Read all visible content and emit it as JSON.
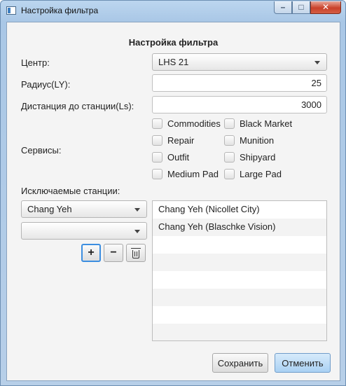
{
  "window": {
    "title": "Настройка фильтра",
    "controls": {
      "minimize": "–",
      "maximize": "□",
      "close": "✕"
    }
  },
  "form": {
    "heading": "Настройка фильтра",
    "center": {
      "label": "Центр:",
      "value": "LHS 21"
    },
    "radius": {
      "label": "Радиус(LY):",
      "value": "25"
    },
    "distance": {
      "label": "Дистанция до станции(Ls):",
      "value": "3000"
    },
    "services": {
      "label": "Сервисы:",
      "items": [
        {
          "label": "Commodities",
          "checked": false
        },
        {
          "label": "Black Market",
          "checked": false
        },
        {
          "label": "Repair",
          "checked": false
        },
        {
          "label": "Munition",
          "checked": false
        },
        {
          "label": "Outfit",
          "checked": false
        },
        {
          "label": "Shipyard",
          "checked": false
        },
        {
          "label": "Medium Pad",
          "checked": false
        },
        {
          "label": "Large Pad",
          "checked": false
        }
      ]
    },
    "excluded": {
      "label": "Исключаемые станции:",
      "system_value": "Chang Yeh",
      "station_value": "",
      "add_label": "+",
      "remove_label": "−",
      "delete_icon": "trash-icon",
      "items": [
        "Chang Yeh (Nicollet City)",
        "Chang Yeh (Blaschke Vision)"
      ]
    }
  },
  "footer": {
    "save_label": "Сохранить",
    "cancel_label": "Отменить"
  },
  "colors": {
    "accent": "#3c8ee0",
    "default_button": "#a9d1f3",
    "close_button": "#c9412a"
  }
}
